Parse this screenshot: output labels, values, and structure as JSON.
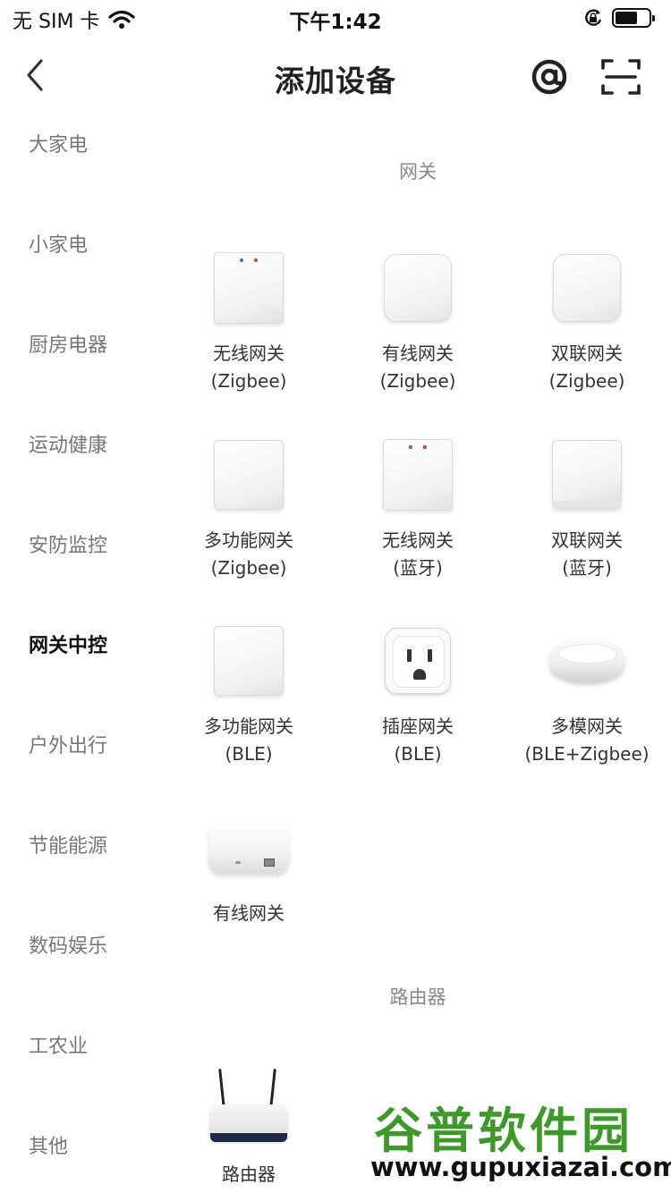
{
  "status_bar": {
    "carrier": "无 SIM 卡",
    "time": "下午1:42"
  },
  "nav": {
    "title": "添加设备"
  },
  "sidebar": {
    "items": [
      {
        "label": "大家电"
      },
      {
        "label": "小家电"
      },
      {
        "label": "厨房电器"
      },
      {
        "label": "运动健康"
      },
      {
        "label": "安防监控"
      },
      {
        "label": "网关中控",
        "active": true
      },
      {
        "label": "户外出行"
      },
      {
        "label": "节能能源"
      },
      {
        "label": "数码娱乐"
      },
      {
        "label": "工农业"
      },
      {
        "label": "其他"
      }
    ]
  },
  "sections": [
    {
      "title": "网关",
      "devices": [
        {
          "line1": "无线网关",
          "line2": "(Zigbee)"
        },
        {
          "line1": "有线网关",
          "line2": "(Zigbee)"
        },
        {
          "line1": "双联网关",
          "line2": "(Zigbee)"
        },
        {
          "line1": "多功能网关",
          "line2": "(Zigbee)"
        },
        {
          "line1": "无线网关",
          "line2": "(蓝牙)"
        },
        {
          "line1": "双联网关",
          "line2": "(蓝牙)"
        },
        {
          "line1": "多功能网关",
          "line2": "(BLE)"
        },
        {
          "line1": "插座网关",
          "line2": "(BLE)"
        },
        {
          "line1": "多模网关",
          "line2": "(BLE+Zigbee)"
        },
        {
          "line1": "有线网关",
          "line2": ""
        }
      ]
    },
    {
      "title": "路由器",
      "devices": [
        {
          "line1": "路由器",
          "line2": ""
        }
      ]
    }
  ],
  "watermark": {
    "title": "谷普软件园",
    "url": "www.gupuxiazai.com"
  },
  "icons": {
    "back": "chevron-left-icon",
    "at": "at-sign-icon",
    "scan": "scan-icon",
    "wifi": "wifi-icon",
    "orientation_lock": "orientation-lock-icon",
    "battery": "battery-icon"
  }
}
